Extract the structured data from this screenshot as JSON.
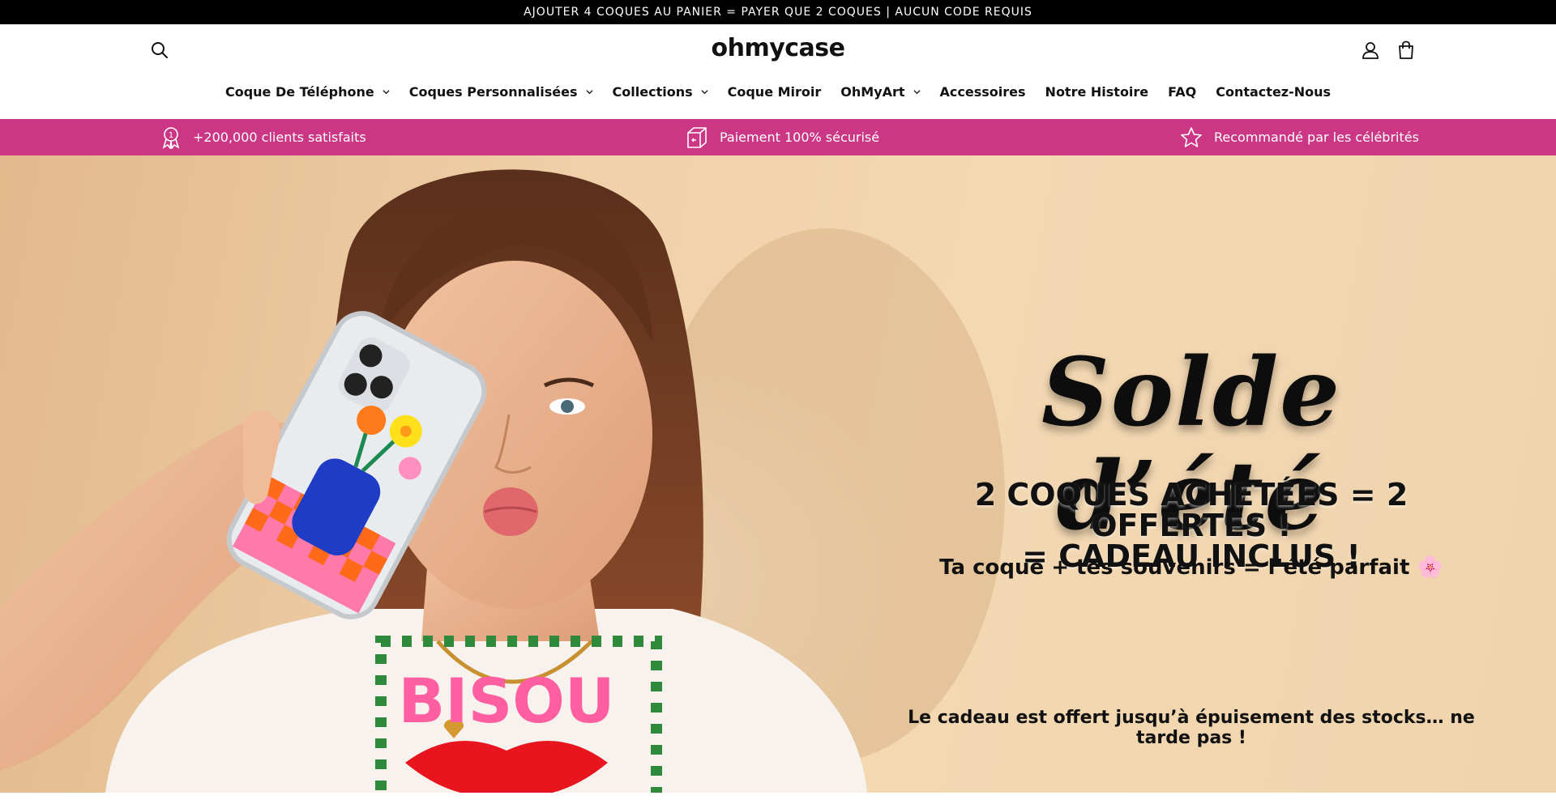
{
  "announcement": {
    "text": "AJOUTER 4 COQUES AU PANIER = PAYER QUE 2 COQUES | AUCUN CODE REQUIS"
  },
  "header": {
    "logo": "ohmycase",
    "icons": {
      "search": "search-icon",
      "account": "user-icon",
      "cart": "shopping-bag-icon"
    }
  },
  "nav": {
    "items": [
      {
        "label": "Coque De Téléphone",
        "has_dropdown": true
      },
      {
        "label": "Coques Personnalisées",
        "has_dropdown": true
      },
      {
        "label": "Collections",
        "has_dropdown": true
      },
      {
        "label": "Coque Miroir",
        "has_dropdown": false
      },
      {
        "label": "OhMyArt",
        "has_dropdown": true
      },
      {
        "label": "Accessoires",
        "has_dropdown": false
      },
      {
        "label": "Notre Histoire",
        "has_dropdown": false
      },
      {
        "label": "FAQ",
        "has_dropdown": false
      },
      {
        "label": "Contactez-Nous",
        "has_dropdown": false
      }
    ]
  },
  "trust_bar": {
    "color": "#cc3785",
    "items": [
      {
        "icon": "award-ribbon-icon",
        "label": "+200,000 clients satisfaits"
      },
      {
        "icon": "secure-box-icon",
        "label": "Paiement 100% sécurisé"
      },
      {
        "icon": "star-icon",
        "label": "Recommandé par les célébrités"
      }
    ]
  },
  "hero": {
    "title": "Solde d’été",
    "promo_line1": "2 COQUES ACHETÉES = 2 OFFERTES !",
    "promo_line2": "= CADEAU INCLUS !",
    "subline": "Ta coque + tes souvenirs = l’été parfait",
    "subline_emoji": "🌸",
    "footnote": "Le cadeau est offert jusqu’à épuisement des stocks… ne tarde pas !",
    "tshirt_text": "BISOU"
  }
}
